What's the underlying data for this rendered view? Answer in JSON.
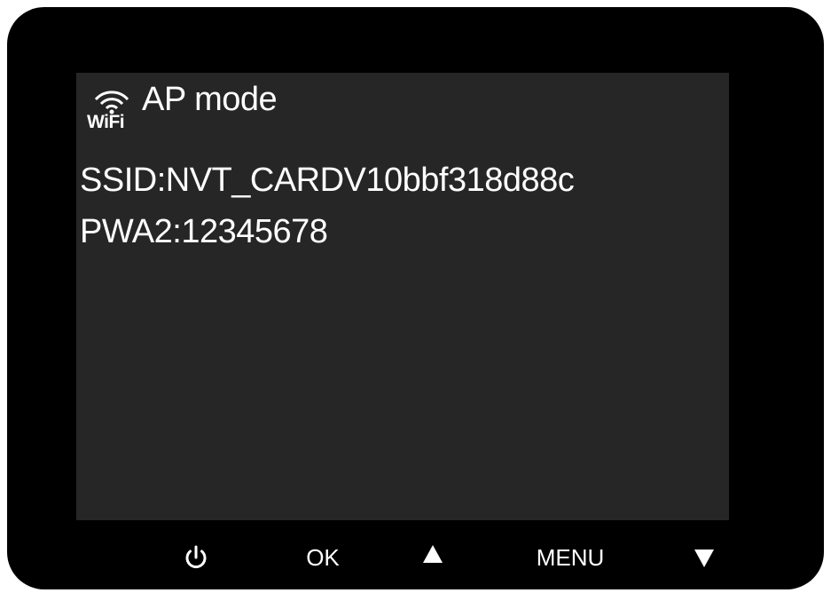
{
  "screen": {
    "mode_icon": "wifi-icon",
    "wifi_text": "WiFi",
    "mode_label": "AP mode",
    "ssid_line": "SSID:NVT_CARDV10bbf318d88c",
    "password_line": "PWA2:12345678"
  },
  "buttons": {
    "power_icon": "power-icon",
    "ok_label": "OK",
    "up_icon": "triangle-up-icon",
    "menu_label": "MENU",
    "down_icon": "triangle-down-icon"
  },
  "colors": {
    "device_body": "#000000",
    "screen_bg": "#262626",
    "text": "#ffffff"
  }
}
